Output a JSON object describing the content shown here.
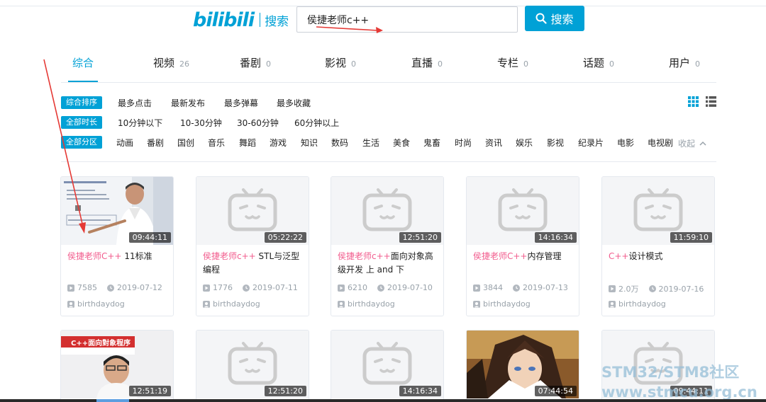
{
  "header": {
    "logo": "bilibili",
    "logo_suffix": "搜索",
    "search_value": "侯捷老师c++",
    "search_button": "搜索"
  },
  "tabs": [
    {
      "label": "综合",
      "count": ""
    },
    {
      "label": "视频",
      "count": "26"
    },
    {
      "label": "番剧",
      "count": "0"
    },
    {
      "label": "影视",
      "count": "0"
    },
    {
      "label": "直播",
      "count": "0"
    },
    {
      "label": "专栏",
      "count": "0"
    },
    {
      "label": "话题",
      "count": "0"
    },
    {
      "label": "用户",
      "count": "0"
    }
  ],
  "filters": {
    "sort": {
      "badge": "综合排序",
      "items": [
        "最多点击",
        "最新发布",
        "最多弹幕",
        "最多收藏"
      ]
    },
    "duration": {
      "badge": "全部时长",
      "items": [
        "10分钟以下",
        "10-30分钟",
        "30-60分钟",
        "60分钟以上"
      ]
    },
    "zone": {
      "badge": "全部分区",
      "items": [
        "动画",
        "番剧",
        "国创",
        "音乐",
        "舞蹈",
        "游戏",
        "知识",
        "数码",
        "生活",
        "美食",
        "鬼畜",
        "时尚",
        "资讯",
        "娱乐",
        "影视",
        "纪录片",
        "电影",
        "电视剧"
      ],
      "collapse": "收起"
    }
  },
  "videos": [
    {
      "duration": "09:44:11",
      "title_hl": "侯捷老师C++",
      "title_rest": " 11标准",
      "views": "7585",
      "date": "2019-07-12",
      "uploader": "birthdaydog",
      "thumb": "lecture"
    },
    {
      "duration": "05:22:22",
      "title_hl": "侯捷老师c++",
      "title_rest": " STL与泛型编程",
      "views": "1776",
      "date": "2019-07-11",
      "uploader": "birthdaydog",
      "thumb": "placeholder"
    },
    {
      "duration": "12:51:20",
      "title_hl": "侯捷老师c++",
      "title_rest": "面向对象高级开发 上 and 下",
      "views": "6210",
      "date": "2019-07-10",
      "uploader": "birthdaydog",
      "thumb": "placeholder"
    },
    {
      "duration": "14:16:34",
      "title_hl": "侯捷老师C++",
      "title_rest": "内存管理",
      "views": "3844",
      "date": "2019-07-13",
      "uploader": "birthdaydog",
      "thumb": "placeholder"
    },
    {
      "duration": "11:59:10",
      "title_hl": "C++",
      "title_rest": "设计模式",
      "views": "2.0万",
      "date": "2019-07-16",
      "uploader": "birthdaydog",
      "thumb": "placeholder"
    },
    {
      "duration": "12:51:19",
      "thumb": "oop",
      "thumb_caption": "C++面向對象程序"
    },
    {
      "duration": "12:51:20",
      "thumb": "placeholder"
    },
    {
      "duration": "14:16:34",
      "thumb": "placeholder"
    },
    {
      "duration": "07:44:54",
      "thumb": "anime"
    },
    {
      "duration": "09:44:11",
      "thumb": "placeholder"
    }
  ],
  "watermark": {
    "line1": "STM32/STM8社区",
    "line2": "www.stmcu.org.cn"
  },
  "colors": {
    "brand": "#00a1d6",
    "highlight": "#f25d8e",
    "meta": "#99a2aa",
    "annotation_arrow": "#e53935"
  }
}
